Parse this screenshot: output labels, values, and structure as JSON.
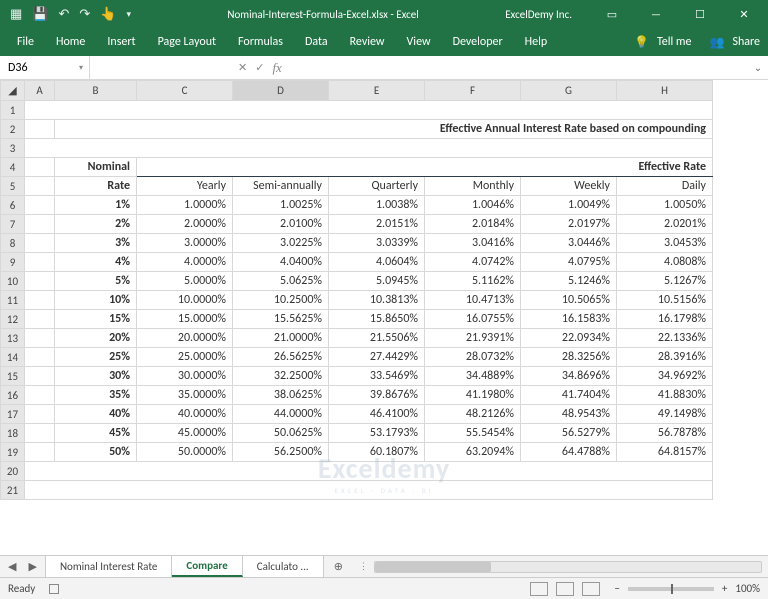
{
  "titlebar": {
    "filename": "Nominal-Interest-Formula-Excel.xlsx - Excel",
    "company": "ExcelDemy Inc.",
    "qat_icons": [
      "excel",
      "save",
      "undo",
      "redo",
      "touch",
      "dropdown"
    ]
  },
  "ribbon": {
    "tabs": [
      "File",
      "Home",
      "Insert",
      "Page Layout",
      "Formulas",
      "Data",
      "Review",
      "View",
      "Developer",
      "Help"
    ],
    "tellme": "Tell me",
    "share": "Share"
  },
  "namebox": {
    "cell": "D36"
  },
  "fx": {
    "cancel": "✕",
    "ok": "✓",
    "fx": "fx",
    "formula": ""
  },
  "col_heads": [
    "A",
    "B",
    "C",
    "D",
    "E",
    "F",
    "G",
    "H"
  ],
  "selected_col": "D",
  "row_heads": [
    "1",
    "2",
    "3",
    "4",
    "5",
    "6",
    "7",
    "8",
    "9",
    "10",
    "11",
    "12",
    "13",
    "14",
    "15",
    "16",
    "17",
    "18",
    "19",
    "20",
    "21"
  ],
  "title": "Effective Annual Interest Rate based on compounding",
  "headers": {
    "nominal_top": "Nominal",
    "nominal_bottom": "Rate",
    "effective": "Effective Rate",
    "periods": [
      "Yearly",
      "Semi-annually",
      "Quarterly",
      "Monthly",
      "Weekly",
      "Daily"
    ]
  },
  "rows": [
    {
      "n": "1%",
      "v": [
        "1.0000%",
        "1.0025%",
        "1.0038%",
        "1.0046%",
        "1.0049%",
        "1.0050%"
      ]
    },
    {
      "n": "2%",
      "v": [
        "2.0000%",
        "2.0100%",
        "2.0151%",
        "2.0184%",
        "2.0197%",
        "2.0201%"
      ]
    },
    {
      "n": "3%",
      "v": [
        "3.0000%",
        "3.0225%",
        "3.0339%",
        "3.0416%",
        "3.0446%",
        "3.0453%"
      ]
    },
    {
      "n": "4%",
      "v": [
        "4.0000%",
        "4.0400%",
        "4.0604%",
        "4.0742%",
        "4.0795%",
        "4.0808%"
      ]
    },
    {
      "n": "5%",
      "v": [
        "5.0000%",
        "5.0625%",
        "5.0945%",
        "5.1162%",
        "5.1246%",
        "5.1267%"
      ]
    },
    {
      "n": "10%",
      "v": [
        "10.0000%",
        "10.2500%",
        "10.3813%",
        "10.4713%",
        "10.5065%",
        "10.5156%"
      ]
    },
    {
      "n": "15%",
      "v": [
        "15.0000%",
        "15.5625%",
        "15.8650%",
        "16.0755%",
        "16.1583%",
        "16.1798%"
      ]
    },
    {
      "n": "20%",
      "v": [
        "20.0000%",
        "21.0000%",
        "21.5506%",
        "21.9391%",
        "22.0934%",
        "22.1336%"
      ]
    },
    {
      "n": "25%",
      "v": [
        "25.0000%",
        "26.5625%",
        "27.4429%",
        "28.0732%",
        "28.3256%",
        "28.3916%"
      ]
    },
    {
      "n": "30%",
      "v": [
        "30.0000%",
        "32.2500%",
        "33.5469%",
        "34.4889%",
        "34.8696%",
        "34.9692%"
      ]
    },
    {
      "n": "35%",
      "v": [
        "35.0000%",
        "38.0625%",
        "39.8676%",
        "41.1980%",
        "41.7404%",
        "41.8830%"
      ]
    },
    {
      "n": "40%",
      "v": [
        "40.0000%",
        "44.0000%",
        "46.4100%",
        "48.2126%",
        "48.9543%",
        "49.1498%"
      ]
    },
    {
      "n": "45%",
      "v": [
        "45.0000%",
        "50.0625%",
        "53.1793%",
        "55.5454%",
        "56.5279%",
        "56.7878%"
      ]
    },
    {
      "n": "50%",
      "v": [
        "50.0000%",
        "56.2500%",
        "60.1807%",
        "63.2094%",
        "64.4788%",
        "64.8157%"
      ]
    }
  ],
  "sheet_tabs": {
    "nav_prev": "◀",
    "nav_next": "▶",
    "tabs": [
      {
        "label": "Nominal Interest Rate",
        "active": false
      },
      {
        "label": "Compare",
        "active": true
      },
      {
        "label": "Calculato ...",
        "active": false
      }
    ],
    "add": "⊕"
  },
  "statusbar": {
    "ready": "Ready",
    "zoom": "100%",
    "minus": "−",
    "plus": "+"
  },
  "watermark": {
    "brand": "Exceldemy",
    "tagline": "EXCEL · DATA · BI"
  }
}
